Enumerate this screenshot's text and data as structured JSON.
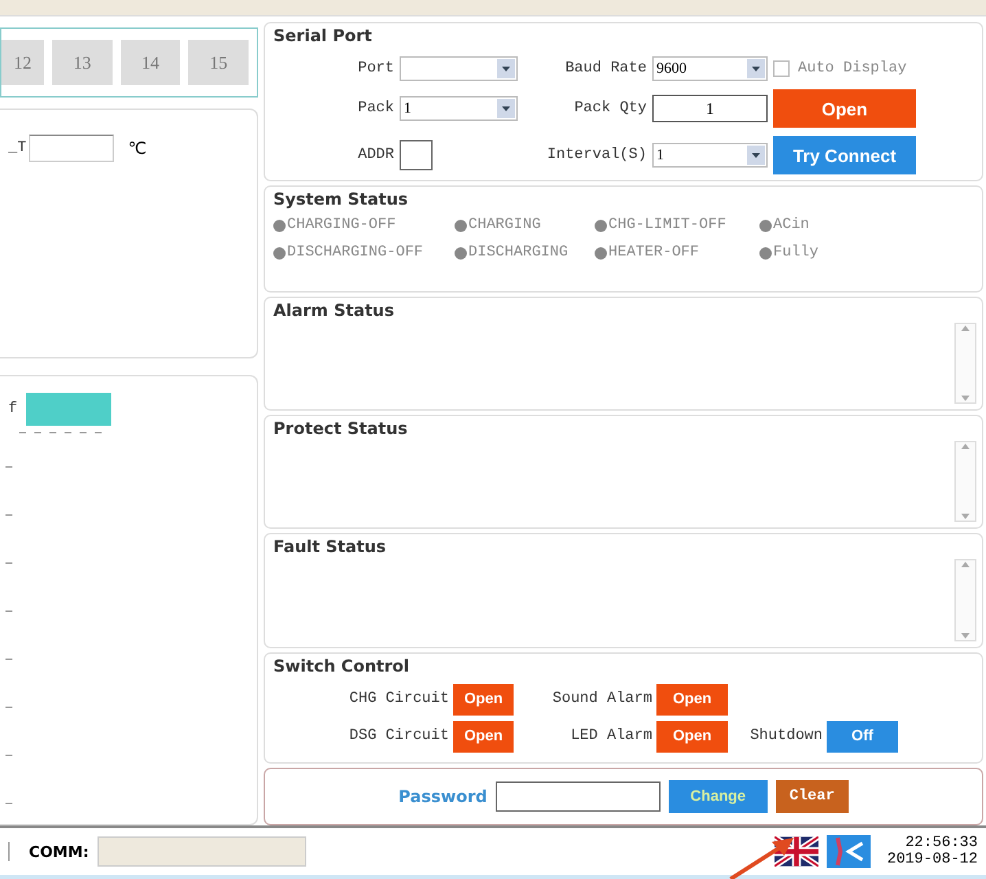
{
  "cell_tabs": [
    {
      "label": "12"
    },
    {
      "label": "13"
    },
    {
      "label": "14"
    },
    {
      "label": "15"
    }
  ],
  "temperature_panel": {
    "label": "_T",
    "unit": "℃"
  },
  "color_panel": {
    "label": "f"
  },
  "serial_port": {
    "title": "Serial Port",
    "port": {
      "label": "Port"
    },
    "baud_rate": {
      "label": "Baud Rate",
      "value": "9600"
    },
    "auto_display": {
      "label": "Auto Display",
      "checked": false
    },
    "pack": {
      "label": "Pack",
      "value": "1"
    },
    "pack_qty": {
      "label": "Pack Qty",
      "value": "1"
    },
    "open_button": "Open",
    "addr": {
      "label": "ADDR"
    },
    "interval": {
      "label": "Interval(S)",
      "value": "1"
    },
    "connect_button": "Try Connect"
  },
  "system_status": {
    "title": "System Status",
    "indicators": [
      {
        "label": "CHARGING-OFF"
      },
      {
        "label": "CHARGING"
      },
      {
        "label": "CHG-LIMIT-OFF"
      },
      {
        "label": "ACin"
      },
      {
        "label": "DISCHARGING-OFF"
      },
      {
        "label": "DISCHARGING"
      },
      {
        "label": "HEATER-OFF"
      },
      {
        "label": "Fully"
      }
    ]
  },
  "alarm_status": {
    "title": "Alarm Status"
  },
  "protect_status": {
    "title": "Protect Status"
  },
  "fault_status": {
    "title": "Fault Status"
  },
  "switch_control": {
    "title": "Switch Control",
    "switches": [
      {
        "label": "CHG Circuit",
        "button": "Open",
        "kind": "open"
      },
      {
        "label": "Sound Alarm",
        "button": "Open",
        "kind": "open"
      },
      {
        "label": "DSG Circuit",
        "button": "Open",
        "kind": "open"
      },
      {
        "label": "LED Alarm",
        "button": "Open",
        "kind": "open"
      },
      {
        "label": "Shutdown",
        "button": "Off",
        "kind": "off"
      }
    ]
  },
  "password": {
    "label": "Password",
    "buttons": [
      {
        "label": "Change",
        "kind": "change"
      },
      {
        "label": "Clear",
        "kind": "clear"
      }
    ]
  },
  "status_bar": {
    "comm_label": "COMM:",
    "time": "22:56:33",
    "date": "2019-08-12"
  }
}
